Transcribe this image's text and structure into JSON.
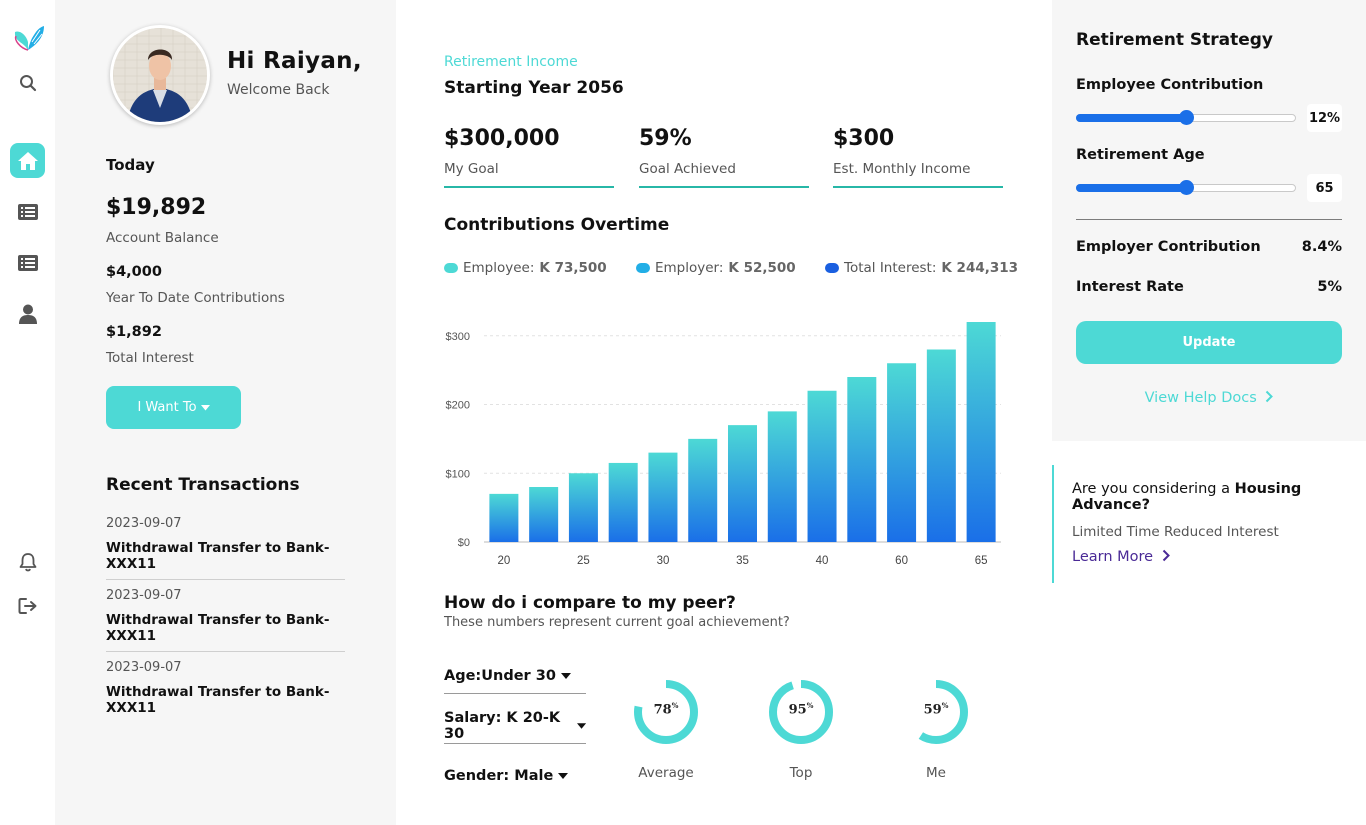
{
  "user": {
    "greeting": "Hi Raiyan,",
    "welcome": "Welcome Back"
  },
  "summary": {
    "today_label": "Today",
    "balance": "$19,892",
    "balance_label": "Account Balance",
    "ytd": "$4,000",
    "ytd_label": "Year To Date Contributions",
    "interest": "$1,892",
    "interest_label": "Total Interest",
    "want_button": "I Want To"
  },
  "transactions": {
    "title": "Recent Transactions",
    "items": [
      {
        "date": "2023-09-07",
        "desc": "Withdrawal Transfer to Bank-XXX11"
      },
      {
        "date": "2023-09-07",
        "desc": "Withdrawal Transfer to Bank-XXX11"
      },
      {
        "date": "2023-09-07",
        "desc": "Withdrawal Transfer to Bank-XXX11"
      }
    ]
  },
  "income": {
    "subtitle": "Retirement Income",
    "title": "Starting Year 2056",
    "kpis": [
      {
        "value": "$300,000",
        "label": "My Goal"
      },
      {
        "value": "59%",
        "label": "Goal Achieved"
      },
      {
        "value": "$300",
        "label": "Est. Monthly Income"
      }
    ]
  },
  "contributions": {
    "title": "Contributions Overtime",
    "legend": [
      {
        "name": "Employee:",
        "value": "K 73,500",
        "color": "#4dd9d5"
      },
      {
        "name": "Employer:",
        "value": "K 52,500",
        "color": "#22aee6"
      },
      {
        "name": "Total Interest:",
        "value": "K 244,313",
        "color": "#1a5fe0"
      }
    ]
  },
  "chart_data": {
    "type": "bar",
    "categories": [
      "20",
      "",
      "25",
      "",
      "30",
      "",
      "35",
      "",
      "40",
      "",
      "60",
      "",
      "65"
    ],
    "x_tick_labels": [
      "20",
      "25",
      "30",
      "35",
      "40",
      "60",
      "65"
    ],
    "values": [
      70,
      80,
      100,
      115,
      130,
      150,
      170,
      190,
      220,
      240,
      260,
      280,
      320
    ],
    "y_tick_labels": [
      "$0",
      "$100",
      "$200",
      "$300"
    ],
    "ylim": [
      0,
      320
    ],
    "grid": true,
    "colors": {
      "top": "#4dd9d5",
      "bottom": "#1a6fe8"
    }
  },
  "peer": {
    "title": "How do i compare to my peer?",
    "subtitle": "These numbers represent current goal achievement?",
    "filters": [
      "Age:Under 30",
      "Salary: K 20-K 30",
      "Gender: Male"
    ],
    "donuts": [
      {
        "value": "78",
        "pct": 78,
        "label": "Average"
      },
      {
        "value": "95",
        "pct": 95,
        "label": "Top"
      },
      {
        "value": "59",
        "pct": 59,
        "label": "Me"
      }
    ],
    "percent_sign": "%"
  },
  "strategy": {
    "title": "Retirement Strategy",
    "employee_label": "Employee Contribution",
    "employee_value": "12%",
    "employee_level": 0.5,
    "age_label": "Retirement Age",
    "age_value": "65",
    "age_level": 0.5,
    "employer_label": "Employer Contribution",
    "employer_value": "8.4%",
    "rate_label": "Interest Rate",
    "rate_value": "5%",
    "update_button": "Update",
    "help_link": "View Help Docs"
  },
  "promo": {
    "question_prefix": "Are you considering a ",
    "question_bold": "Housing Advance?",
    "subtitle": "Limited Time Reduced Interest",
    "link": "Learn More"
  },
  "icons": [
    "logo-butterfly-icon",
    "search-icon",
    "home-icon",
    "list-icon",
    "list-icon",
    "user-icon",
    "bell-icon",
    "logout-icon"
  ],
  "colors": {
    "accent": "#4dd9d5",
    "blue": "#1a6fe8",
    "purple": "#4a2a96"
  }
}
